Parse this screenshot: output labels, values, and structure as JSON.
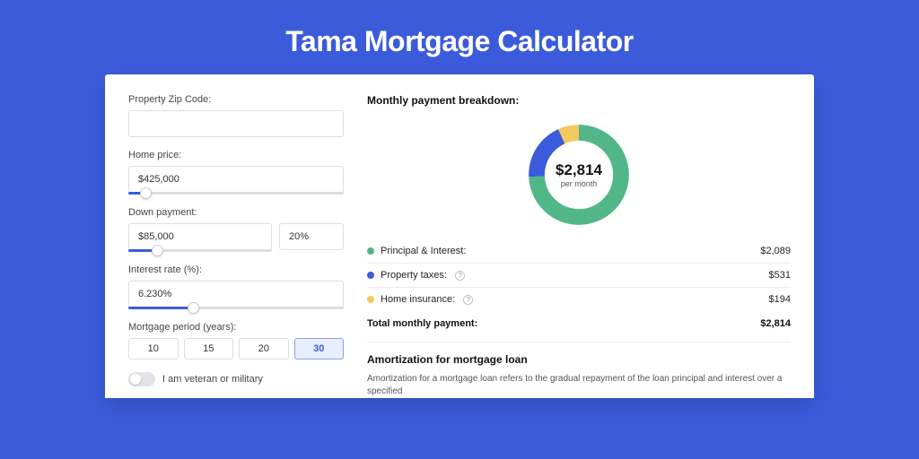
{
  "title": "Tama Mortgage Calculator",
  "form": {
    "zip": {
      "label": "Property Zip Code:",
      "value": ""
    },
    "home_price": {
      "label": "Home price:",
      "value": "$425,000",
      "slider_pct": 8
    },
    "down_payment": {
      "label": "Down payment:",
      "value": "$85,000",
      "pct_value": "20%",
      "slider_pct": 20
    },
    "interest_rate": {
      "label": "Interest rate (%):",
      "value": "6.230%",
      "slider_pct": 30
    },
    "period": {
      "label": "Mortgage period (years):",
      "options": [
        "10",
        "15",
        "20",
        "30"
      ],
      "selected": "30"
    },
    "veteran": {
      "label": "I am veteran or military",
      "on": false
    }
  },
  "breakdown": {
    "title": "Monthly payment breakdown:",
    "center_amount": "$2,814",
    "center_caption": "per month",
    "items": [
      {
        "label": "Principal & Interest:",
        "value": "$2,089",
        "color": "#52b788",
        "help": false,
        "numeric": 2089
      },
      {
        "label": "Property taxes:",
        "value": "$531",
        "color": "#3B5BDB",
        "help": true,
        "numeric": 531
      },
      {
        "label": "Home insurance:",
        "value": "$194",
        "color": "#f4c95d",
        "help": true,
        "numeric": 194
      }
    ],
    "total_label": "Total monthly payment:",
    "total_value": "$2,814",
    "total_numeric": 2814
  },
  "amortization": {
    "title": "Amortization for mortgage loan",
    "body": "Amortization for a mortgage loan refers to the gradual repayment of the loan principal and interest over a specified"
  },
  "chart_data": {
    "type": "pie",
    "title": "Monthly payment breakdown",
    "series": [
      {
        "name": "Principal & Interest",
        "value": 2089
      },
      {
        "name": "Property taxes",
        "value": 531
      },
      {
        "name": "Home insurance",
        "value": 194
      }
    ],
    "total": 2814
  }
}
